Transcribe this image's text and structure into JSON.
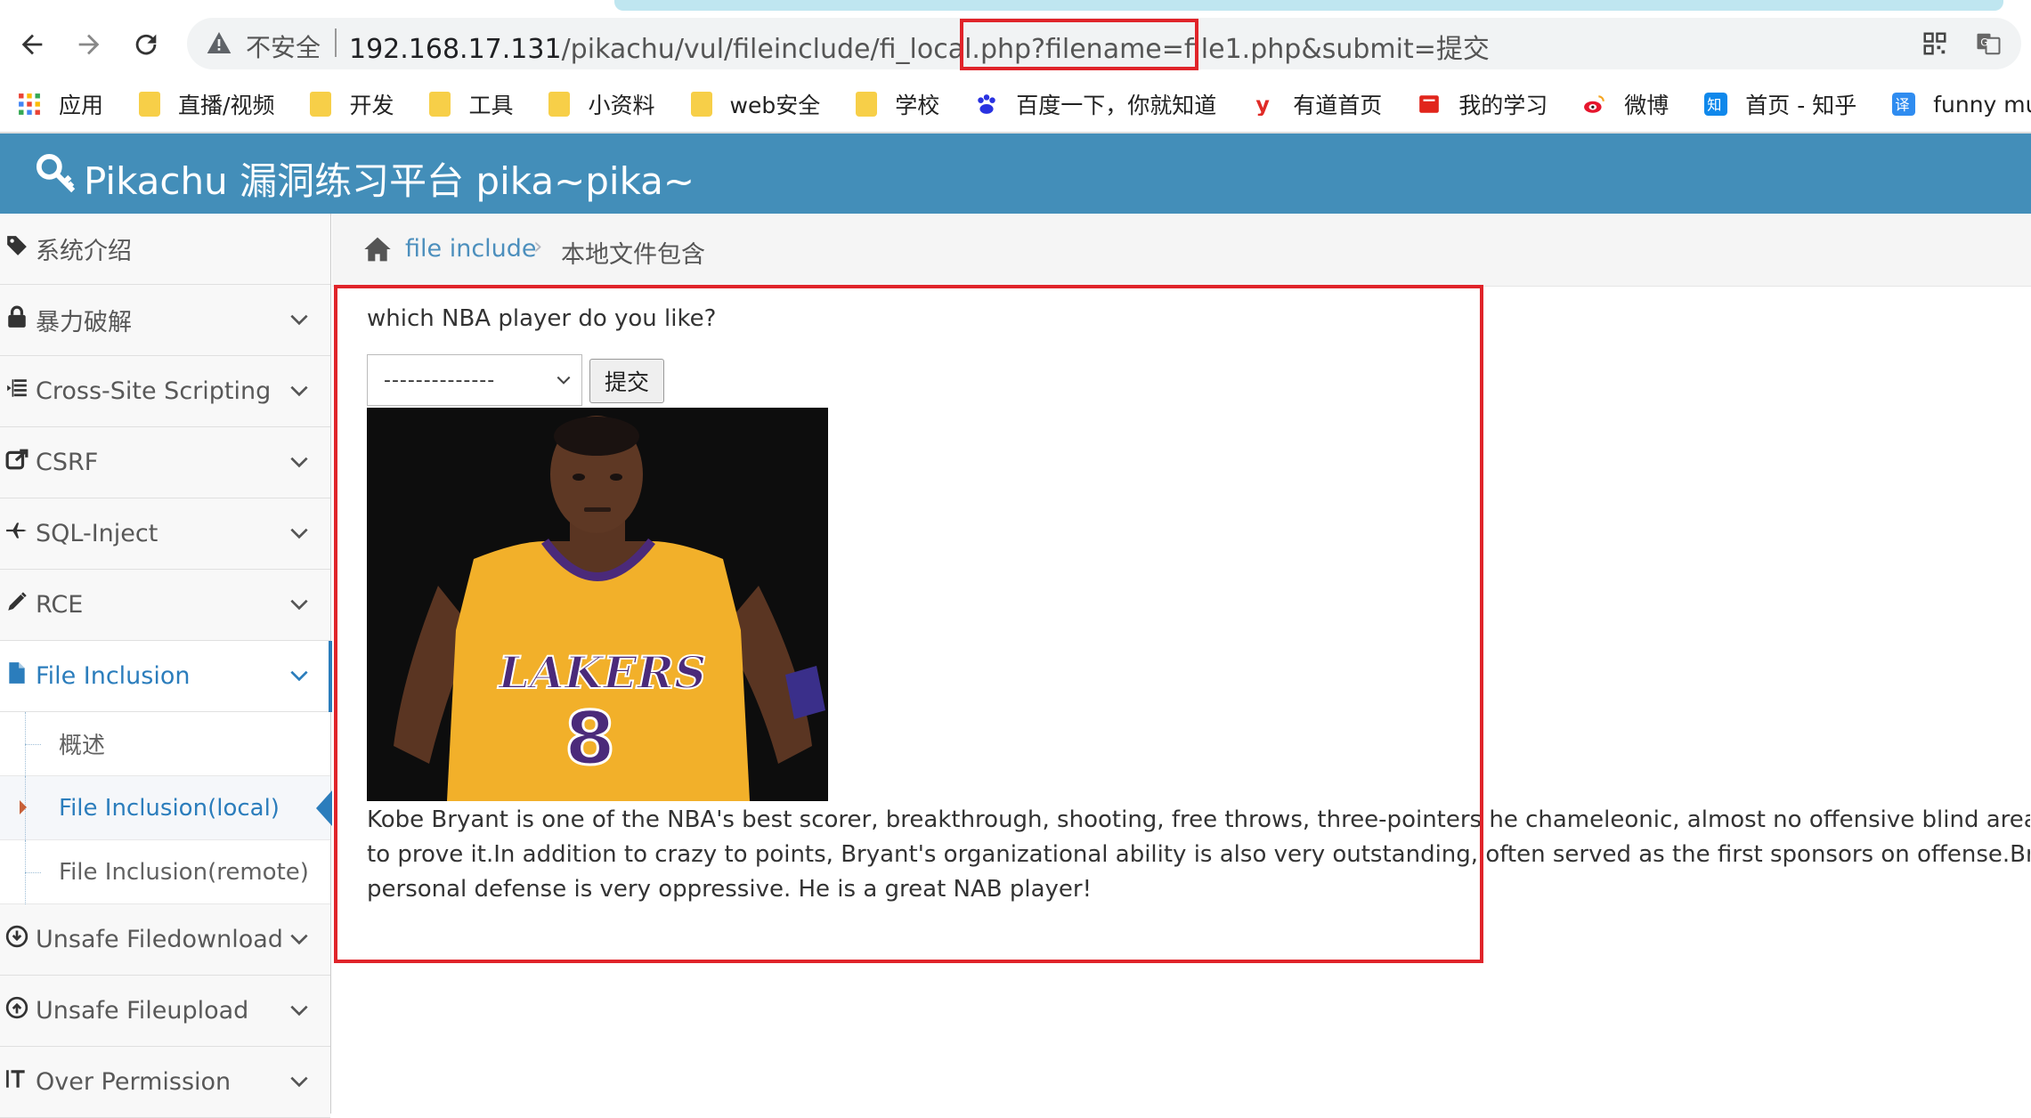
{
  "browser": {
    "security_label": "不安全",
    "url_host": "192.168.17.131",
    "url_path": "/pikachu/vul/fileinclude/fi_local.php",
    "url_query_highlight": "?filename=file1.php",
    "url_query_rest": "&submit=提交",
    "bookmarks": [
      {
        "label": "应用",
        "icon": "apps-grid-icon"
      },
      {
        "label": "直播/视频",
        "icon": "folder-icon"
      },
      {
        "label": "开发",
        "icon": "folder-icon"
      },
      {
        "label": "工具",
        "icon": "folder-icon"
      },
      {
        "label": "小资料",
        "icon": "folder-icon"
      },
      {
        "label": "web安全",
        "icon": "folder-icon"
      },
      {
        "label": "学校",
        "icon": "folder-icon"
      },
      {
        "label": "百度一下，你就知道",
        "icon": "baidu-paw-icon"
      },
      {
        "label": "有道首页",
        "icon": "youdao-icon"
      },
      {
        "label": "我的学习",
        "icon": "red-book-icon"
      },
      {
        "label": "微博",
        "icon": "weibo-icon"
      },
      {
        "label": "首页 - 知乎",
        "icon": "zhihu-icon"
      },
      {
        "label": "funny mud pee",
        "icon": "translate-icon"
      }
    ]
  },
  "app": {
    "title": "Pikachu 漏洞练习平台 pika~pika~",
    "accent": "#438eb9"
  },
  "sidebar": {
    "items": [
      {
        "label": "系统介绍",
        "icon": "tags-icon"
      },
      {
        "label": "暴力破解",
        "icon": "lock-icon"
      },
      {
        "label": "Cross-Site Scripting",
        "icon": "list-indent-icon"
      },
      {
        "label": "CSRF",
        "icon": "share-square-icon"
      },
      {
        "label": "SQL-Inject",
        "icon": "fighter-jet-icon"
      },
      {
        "label": "RCE",
        "icon": "pencil-icon"
      },
      {
        "label": "File Inclusion",
        "icon": "file-icon"
      },
      {
        "label": "Unsafe Filedownload",
        "icon": "download-circle-icon"
      },
      {
        "label": "Unsafe Fileupload",
        "icon": "upload-circle-icon"
      },
      {
        "label": "Over Permission",
        "icon": "text-height-icon"
      }
    ],
    "subitems": [
      {
        "label": "概述"
      },
      {
        "label": "File Inclusion(local)"
      },
      {
        "label": "File Inclusion(remote)"
      }
    ]
  },
  "breadcrumb": {
    "link": "file include",
    "separator": "›",
    "current": "本地文件包含"
  },
  "content": {
    "question": "which NBA player do you like?",
    "select_value": "--------------",
    "submit_label": "提交",
    "description_lines": [
      "Kobe Bryant is one of the NBA's best scorer, breakthrough, shooting, free throws, three-pointers he chameleonic, almost no offensive blind area, single-gam",
      "to prove it.In addition to crazy to points, Bryant's organizational ability is also very outstanding, often served as the first sponsors on offense.Bryant is the b",
      "personal defense is very oppressive. He is a great NAB player!"
    ],
    "jersey_text": "LAKERS",
    "jersey_number": "8"
  }
}
